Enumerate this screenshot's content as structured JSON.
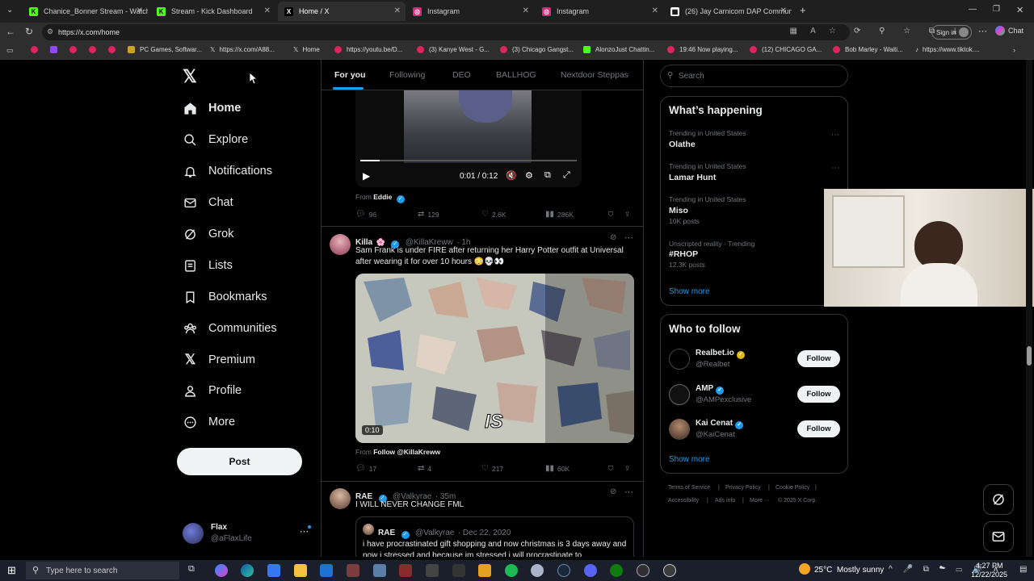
{
  "browser": {
    "tabs": [
      {
        "title": "Chanice_Bonner Stream - Watch L",
        "favicon_color": "#53fc18",
        "favicon_glyph": "K"
      },
      {
        "title": "Stream - Kick Dashboard",
        "favicon_color": "#53fc18",
        "favicon_glyph": "K"
      },
      {
        "title": "Home / X",
        "favicon_color": "#000000",
        "favicon_glyph": "X"
      },
      {
        "title": "Instagram",
        "favicon_color": "#d62976",
        "favicon_glyph": "◎"
      },
      {
        "title": "Instagram",
        "favicon_color": "#d62976",
        "favicon_glyph": "◎"
      },
      {
        "title": "(26) Jay Carnicom DAP Community",
        "favicon_color": "#ffffff",
        "favicon_glyph": "▦"
      }
    ],
    "url": "https://x.com/home",
    "signin_label": "Sign in",
    "chat_label": "Chat",
    "bookmarks": [
      {
        "label": ""
      },
      {
        "label": ""
      },
      {
        "label": ""
      },
      {
        "label": ""
      },
      {
        "label": "PC Games, Softwar..."
      },
      {
        "label": "https://x.com/A88..."
      },
      {
        "label": "Home"
      },
      {
        "label": "https://youtu.be/D..."
      },
      {
        "label": "(3) Kanye West - G..."
      },
      {
        "label": "(3) Chicago Gangst..."
      },
      {
        "label": "AlonzoJust Chattin..."
      },
      {
        "label": "19:46 Now playing..."
      },
      {
        "label": "(12) CHICAGO GA..."
      },
      {
        "label": "Bob Marley - Waiti..."
      },
      {
        "label": "https://www.tiktok...."
      }
    ]
  },
  "sidebar": {
    "items": [
      {
        "label": "Home",
        "icon": "home-icon"
      },
      {
        "label": "Explore",
        "icon": "search-icon"
      },
      {
        "label": "Notifications",
        "icon": "bell-icon"
      },
      {
        "label": "Chat",
        "icon": "mail-icon"
      },
      {
        "label": "Grok",
        "icon": "grok-icon"
      },
      {
        "label": "Lists",
        "icon": "list-icon"
      },
      {
        "label": "Bookmarks",
        "icon": "bookmark-icon"
      },
      {
        "label": "Communities",
        "icon": "people-icon"
      },
      {
        "label": "Premium",
        "icon": "x-logo-icon"
      },
      {
        "label": "Profile",
        "icon": "person-icon"
      },
      {
        "label": "More",
        "icon": "more-circle-icon"
      }
    ],
    "post_label": "Post",
    "account": {
      "name": "Flax",
      "handle": "@aFlaxLife"
    }
  },
  "feed": {
    "tabs": [
      "For you",
      "Following",
      "DEO",
      "BALLHOG",
      "Nextdoor Steppas"
    ],
    "video_time": "0:01 / 0:12",
    "post1": {
      "from_prefix": "From",
      "from_name": "Eddie",
      "replies": "96",
      "reposts": "129",
      "likes": "2.6K",
      "views": "286K"
    },
    "post2": {
      "name": "Killa",
      "handle": "@KillaKreww",
      "time": "· 1h",
      "text": "Sam Frank is under FIRE after returning her Harry Potter outfit at Universal after wearing it for over 10 hours 😳💀👀",
      "video_caption": "IS",
      "duration": "0:10",
      "from_prefix": "From",
      "from_link": "Follow @KillaKreww",
      "replies": "17",
      "reposts": "4",
      "likes": "217",
      "views": "60K"
    },
    "post3": {
      "name": "RAE",
      "handle": "@Valkyrae",
      "time": "· 35m",
      "text": "I WILL NEVER CHANGE FML",
      "quote_name": "RAE",
      "quote_handle": "@Valkyrae",
      "quote_date": "· Dec 22, 2020",
      "quote_text": "i have procrastinated gift shopping and now christmas is 3 days away and now i stressed and because im stressed i will procrastinate to"
    }
  },
  "right": {
    "search_placeholder": "Search",
    "happening_title": "What’s happening",
    "trends": [
      {
        "meta": "Trending in United States",
        "name": "Olathe",
        "count": ""
      },
      {
        "meta": "Trending in United States",
        "name": "Lamar Hunt",
        "count": ""
      },
      {
        "meta": "Trending in United States",
        "name": "Miso",
        "count": "10K posts"
      },
      {
        "meta": "Unscripted reality · Trending",
        "name": "#RHOP",
        "count": "12.3K posts"
      }
    ],
    "show_more": "Show more",
    "follow_title": "Who to follow",
    "follow": [
      {
        "name": "Realbet.io",
        "handle": "@Realbet",
        "button": "Follow"
      },
      {
        "name": "AMP",
        "handle": "@AMPexclusive",
        "button": "Follow"
      },
      {
        "name": "Kai Cenat",
        "handle": "@KaiCenat",
        "button": "Follow"
      }
    ],
    "footer": [
      "Terms of Service",
      "|",
      "Privacy Policy",
      "|",
      "Cookie Policy",
      "|",
      "Accessibility",
      "|",
      "Ads info",
      "|",
      "More ···",
      "© 2025 X Corp."
    ]
  },
  "taskbar": {
    "search_placeholder": "Type here to search",
    "weather": "25°C  Mostly sunny",
    "time": "4:27 PM",
    "date": "12/22/2025"
  },
  "colors": {
    "accent": "#1d9bf0",
    "bg": "#000000",
    "border": "#2f3336",
    "muted": "#71767b"
  }
}
